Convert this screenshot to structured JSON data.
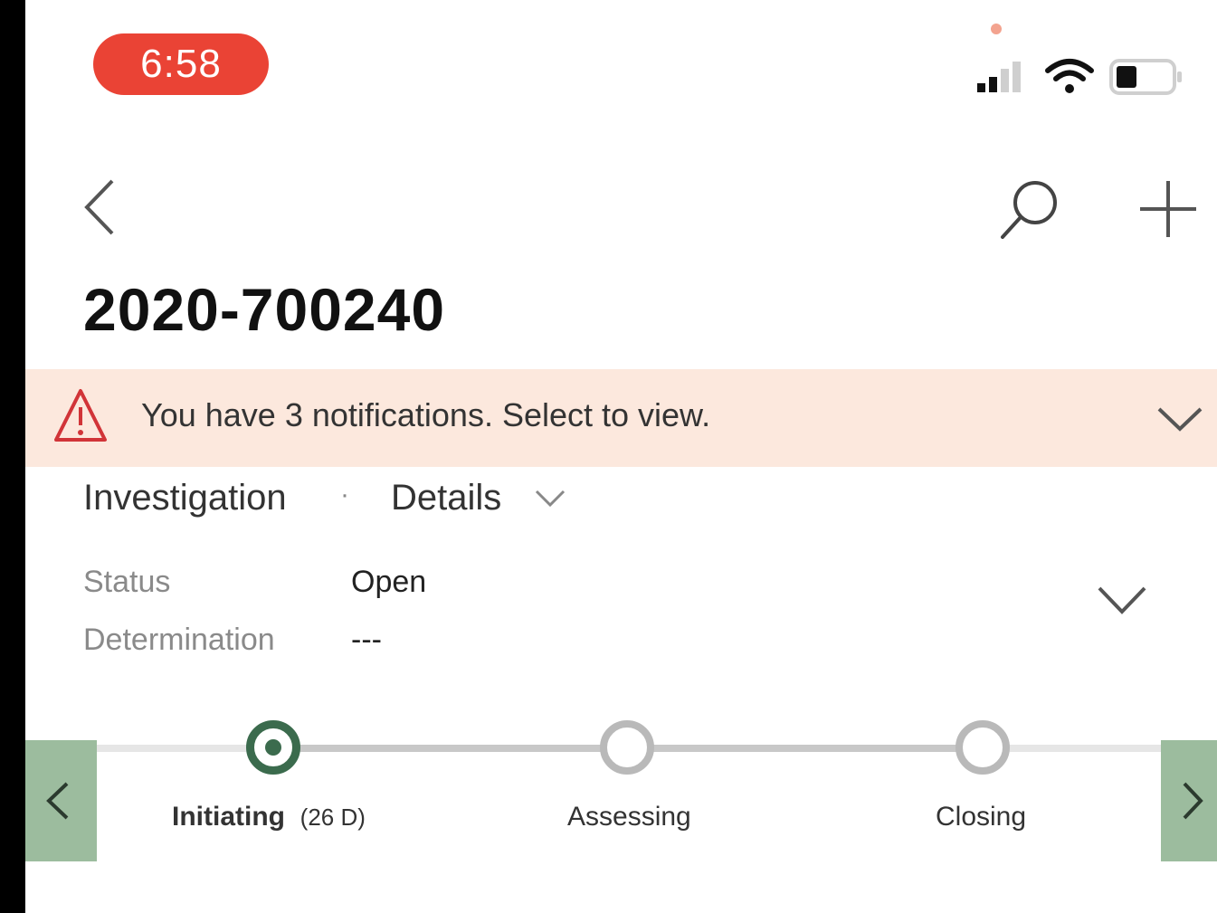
{
  "status_bar": {
    "time": "6:58",
    "signal_icon": "cellular-signal-icon",
    "wifi_icon": "wifi-icon",
    "battery_icon": "battery-icon"
  },
  "nav": {
    "back_icon": "chevron-left-icon",
    "search_icon": "search-icon",
    "add_icon": "plus-icon"
  },
  "record": {
    "title": "2020-700240"
  },
  "notification": {
    "icon": "warning-icon",
    "text": "You have 3 notifications. Select to view.",
    "chevron_icon": "chevron-down-icon"
  },
  "header": {
    "form_name": "Investigation",
    "separator": "·",
    "form_selector": "Details",
    "fields": [
      {
        "label": "Status",
        "value": "Open"
      },
      {
        "label": "Determination",
        "value": "---"
      }
    ]
  },
  "bpf": {
    "stages": [
      {
        "label": "Initiating",
        "duration": "(26 D)",
        "active": true
      },
      {
        "label": "Assessing",
        "active": false
      },
      {
        "label": "Closing",
        "active": false
      }
    ]
  },
  "colors": {
    "time_pill": "#ea4335",
    "notification_bg": "#fce8dd",
    "warning": "#d13438",
    "bpf_active": "#3b6b4d",
    "bpf_nav": "#9cbc9e",
    "bpf_inactive": "#b9b9b9"
  }
}
